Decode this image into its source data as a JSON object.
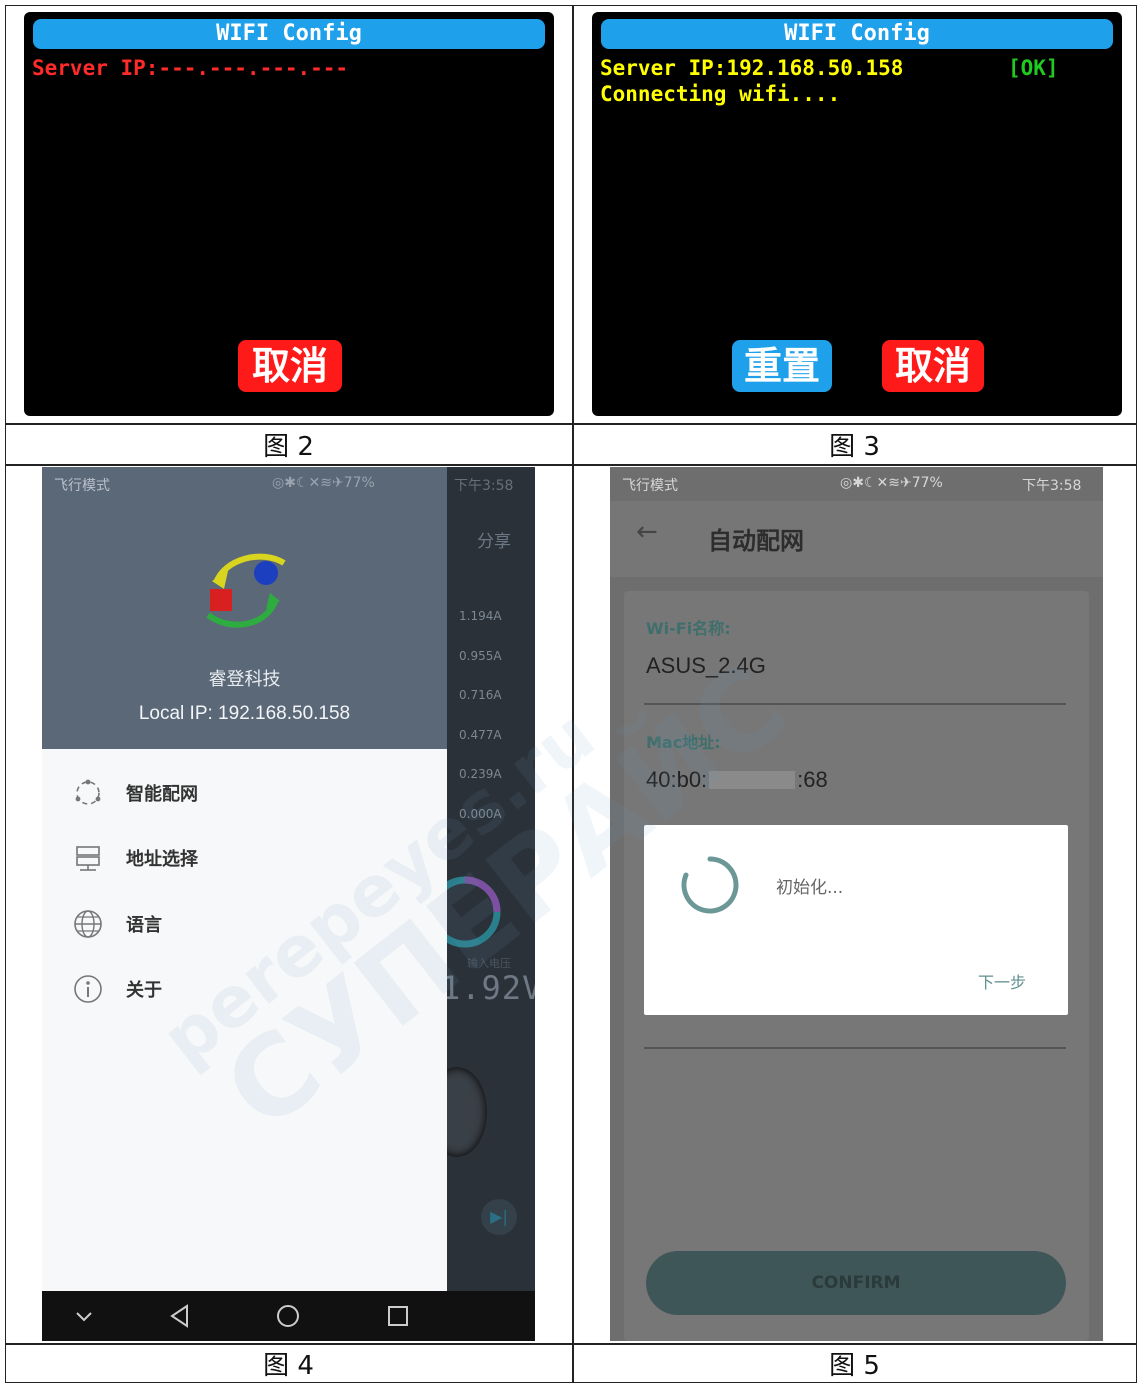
{
  "figures": {
    "fig2": {
      "caption": "图 2",
      "title": "WIFI Config",
      "server_line": "Server IP:---.---.---.---",
      "cancel": "取消",
      "colors": {
        "title_bar": "#1fa0ea",
        "server_text": "#ff2a2a",
        "cancel_button": "#ff1a1a"
      }
    },
    "fig3": {
      "caption": "图 3",
      "title": "WIFI Config",
      "server_line": "Server IP:192.168.50.158",
      "ok": "[OK]",
      "connecting": "Connecting wifi....",
      "reset": "重置",
      "cancel": "取消",
      "colors": {
        "text": "#ffff00",
        "ok": "#1ecb1e",
        "reset_button": "#1fa0ea",
        "cancel_button": "#ff1a1a"
      }
    },
    "fig4": {
      "caption": "图 4",
      "status_left": "飞行模式",
      "status_right": "◎✱☾✕≋✈77%",
      "status_time": "下午3:58",
      "share": "分享",
      "company": "睿登科技",
      "local_ip": "Local IP: 192.168.50.158",
      "scale": [
        "1.194A",
        "0.955A",
        "0.716A",
        "0.477A",
        "0.239A",
        "0.000A"
      ],
      "voltage_label": "输入电压",
      "voltage": "1.92V",
      "menu": [
        {
          "label": "智能配网",
          "icon": "smart-config-icon"
        },
        {
          "label": "地址选择",
          "icon": "server-icon"
        },
        {
          "label": "语言",
          "icon": "globe-icon"
        },
        {
          "label": "关于",
          "icon": "info-icon"
        }
      ],
      "nav": [
        "back-chevron-icon",
        "back-triangle-icon",
        "home-circle-icon",
        "recents-square-icon"
      ]
    },
    "fig5": {
      "caption": "图 5",
      "status_left": "飞行模式",
      "status_right": "◎✱☾✕≋✈77%",
      "status_time": "下午3:58",
      "toolbar_title": "自动配网",
      "wifi_label": "Wi-Fi名称:",
      "wifi_value": "ASUS_2.4G",
      "mac_label": "Mac地址:",
      "mac_prefix": "40:b0:",
      "mac_suffix": ":68",
      "dialog_text": "初始化...",
      "next": "下一步",
      "confirm": "CONFIRM"
    }
  },
  "watermark": {
    "lines": [
      "perepeyes.ru",
      "СУПЕРАЙС"
    ]
  }
}
